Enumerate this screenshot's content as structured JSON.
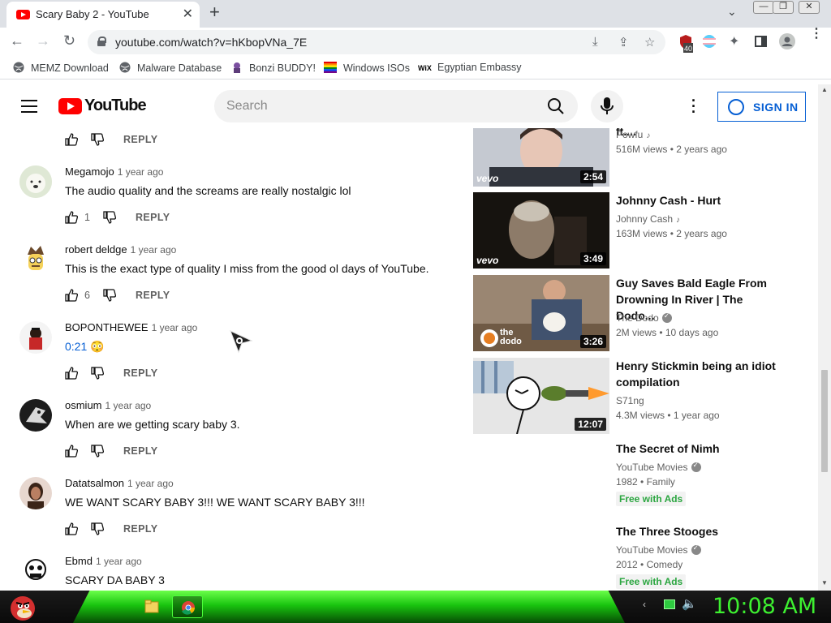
{
  "browser": {
    "tab_title": "Scary Baby 2 - YouTube",
    "tab_close": "✕",
    "new_tab": "+",
    "url": "youtube.com/watch?v=hKbopVNa_7E",
    "extension_badge": "40",
    "bookmarks": [
      {
        "label": "MEMZ Download",
        "icon": "globe-icon"
      },
      {
        "label": "Malware Database",
        "icon": "globe-icon"
      },
      {
        "label": "Bonzi BUDDY!",
        "icon": "bonzi-icon"
      },
      {
        "label": "Windows ISOs",
        "icon": "rainbow-flag-icon"
      },
      {
        "label": "Egyptian Embassy",
        "icon": "wix-icon"
      }
    ]
  },
  "youtube": {
    "logo_text": "YouTube",
    "search_placeholder": "Search",
    "sign_in": "SIGN IN"
  },
  "comments": {
    "top_reply": "REPLY",
    "items": [
      {
        "author": "Megamojo",
        "time": "1 year ago",
        "text": "The audio quality and the screams are really nostalgic lol",
        "likes": "1",
        "reply": "REPLY"
      },
      {
        "author": "robert deldge",
        "time": "1 year ago",
        "text": "This is the exact type of quality I miss from the good ol days of YouTube.",
        "likes": "6",
        "reply": "REPLY"
      },
      {
        "author": "BOPONTHEWEE",
        "time": "1 year ago",
        "link": "0:21",
        "emoji": "😳",
        "likes": "",
        "reply": "REPLY"
      },
      {
        "author": "osmium",
        "time": "1 year ago",
        "text": "When are we getting scary baby 3.",
        "likes": "",
        "reply": "REPLY"
      },
      {
        "author": "Datatsalmon",
        "time": "1 year ago",
        "text": "WE WANT SCARY BABY 3!!! WE WANT SCARY BABY 3!!!",
        "likes": "",
        "reply": "REPLY"
      },
      {
        "author": "Ebmd",
        "time": "1 year ago",
        "text": "SCARY DA BABY 3"
      }
    ]
  },
  "recommendations": [
    {
      "title": "your head) (Official Video) ft....",
      "channel": "Powfu",
      "badge": "music",
      "meta": "516M views • 2 years ago",
      "duration": "2:54",
      "vevo": "vevo"
    },
    {
      "title": "Johnny Cash - Hurt",
      "channel": "Johnny Cash",
      "badge": "music",
      "meta": "163M views • 2 years ago",
      "duration": "3:49",
      "vevo": "vevo"
    },
    {
      "title_line1": "Guy Saves Bald Eagle From",
      "title_line2": "Drowning In River | The Dodo...",
      "channel": "The Dodo",
      "badge": "verified",
      "meta": "2M views • 10 days ago",
      "duration": "3:26",
      "brand": "the dodo"
    },
    {
      "title_line1": "Henry Stickmin being an idiot",
      "title_line2": "compilation",
      "channel": "S71ng",
      "meta": "4.3M views • 1 year ago",
      "duration": "12:07"
    },
    {
      "title": "The Secret of Nimh",
      "channel": "YouTube Movies",
      "badge": "verified",
      "meta": "1982 • Family",
      "free": "Free with Ads"
    },
    {
      "title": "The Three Stooges",
      "channel": "YouTube Movies",
      "badge": "verified",
      "meta": "2012 • Comedy",
      "free": "Free with Ads"
    }
  ],
  "taskbar": {
    "clock": "10:08 AM"
  },
  "colors": {
    "accent_blue": "#065fd4",
    "youtube_red": "#ff0000",
    "free_green": "#2ba640",
    "clock_green": "#3df030"
  }
}
